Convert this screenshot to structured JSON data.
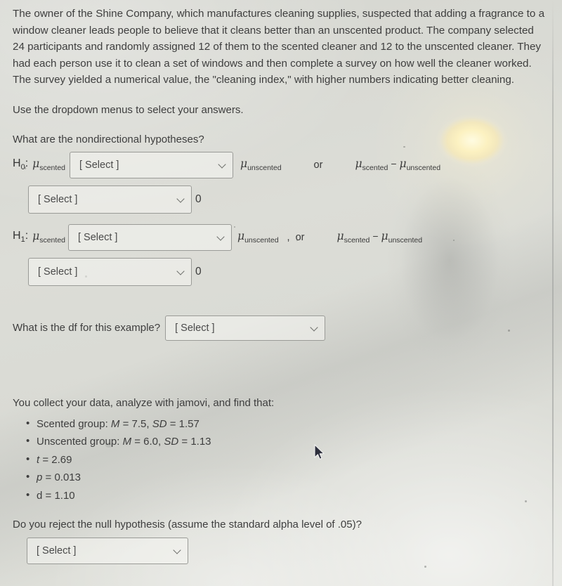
{
  "page": {
    "background_color": "#d8d9d3",
    "text_color": "#3e3e3e",
    "intro_paragraph": "The owner of the Shine Company, which manufactures cleaning supplies, suspected that adding a fragrance to a window cleaner leads people to believe that it cleans better than an unscented product.  The company selected 24 participants and randomly assigned 12 of them to the scented cleaner and 12 to the unscented cleaner.  They had each person use it to clean a set of windows and then complete a survey on how well the cleaner worked.  The survey yielded a numerical value, the \"cleaning index,\" with higher numbers indicating better cleaning.",
    "instruction": "Use the dropdown menus to select your answers."
  },
  "hypotheses": {
    "question": "What are the nondirectional hypotheses?",
    "null": {
      "label": "H",
      "subscript": "0",
      "colon": ":",
      "left_mu": "μ",
      "left_mu_sub": "scented",
      "select_placeholder": "[ Select ]",
      "right_mu": "μ",
      "right_mu_sub": "unscented",
      "separator": "",
      "or_word": "or",
      "alt_left_mu": "μ",
      "alt_left_mu_sub": "scented",
      "alt_minus": "−",
      "alt_right_mu": "μ",
      "alt_right_mu_sub": "unscented",
      "second_select_placeholder": "[ Select ]",
      "second_value": "0"
    },
    "alternative": {
      "label": "H",
      "subscript": "1",
      "colon": ":",
      "left_mu": "μ",
      "left_mu_sub": "scented",
      "select_placeholder": "[ Select ]",
      "right_mu": "μ",
      "right_mu_sub": "unscented",
      "separator": ",",
      "or_word": "or",
      "alt_left_mu": "μ",
      "alt_left_mu_sub": "scented",
      "alt_minus": "−",
      "alt_right_mu": "μ",
      "alt_right_mu_sub": "unscented",
      "second_select_placeholder": "[ Select ]",
      "second_value": "0"
    }
  },
  "df_question": {
    "text": "What is the df for this example?",
    "select_placeholder": "[ Select ]"
  },
  "results": {
    "lead_in": "You collect your data, analyze with jamovi, and find that:",
    "items": [
      {
        "prefix": "Scented group: ",
        "stat1_symbol": "M",
        "stat1_eq": " = 7.5, ",
        "stat2_symbol": "SD",
        "stat2_eq": " = 1.57"
      },
      {
        "prefix": "Unscented group: ",
        "stat1_symbol": "M",
        "stat1_eq": " = 6.0, ",
        "stat2_symbol": "SD",
        "stat2_eq": " = 1.13"
      },
      {
        "prefix": "",
        "stat1_symbol": "t",
        "stat1_eq": " = 2.69",
        "stat2_symbol": "",
        "stat2_eq": ""
      },
      {
        "prefix": "",
        "stat1_symbol": "p",
        "stat1_eq": " = 0.013",
        "stat2_symbol": "",
        "stat2_eq": ""
      },
      {
        "prefix": "",
        "stat1_symbol": "d",
        "stat1_eq": " = 1.10",
        "stat2_symbol": "",
        "stat2_eq": ""
      }
    ]
  },
  "reject_question": {
    "text": "Do you reject the null hypothesis (assume the standard alpha level of .05)?",
    "select_placeholder": "[ Select ]"
  },
  "icons": {
    "dropdown_chevron": "chevron-down-icon",
    "cursor": "mouse-cursor-arrow"
  }
}
